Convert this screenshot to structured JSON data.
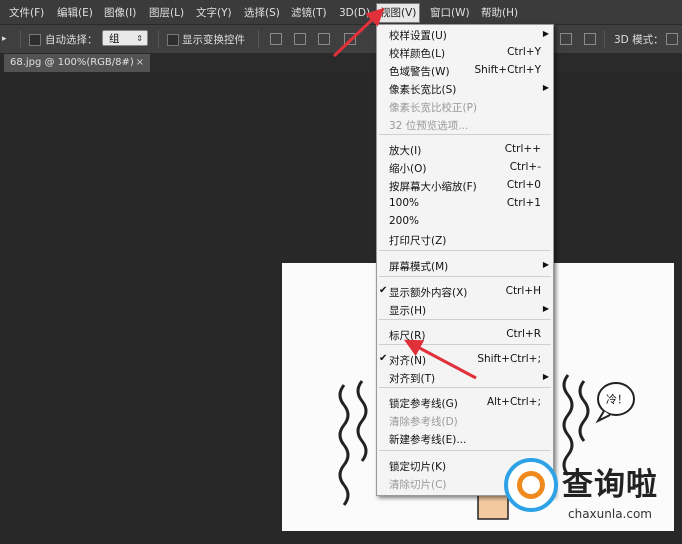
{
  "menubar": {
    "items": [
      "文件(F)",
      "编辑(E)",
      "图像(I)",
      "图层(L)",
      "文字(Y)",
      "选择(S)",
      "滤镜(T)",
      "3D(D)",
      "视图(V)",
      "窗口(W)",
      "帮助(H)"
    ],
    "active_index": 8
  },
  "options_bar": {
    "auto_select_label": "自动选择：",
    "auto_select_value": "组",
    "show_transform_label": "显示变换控件",
    "mode_label": "3D 模式："
  },
  "document_tab": {
    "title": "68.jpg @ 100%(RGB/8#)",
    "close": "×"
  },
  "view_menu": {
    "items": [
      {
        "label": "校样设置(U)",
        "shortcut": "",
        "submenu": true,
        "checked": false,
        "disabled": false
      },
      {
        "label": "校样颜色(L)",
        "shortcut": "Ctrl+Y",
        "submenu": false,
        "checked": false,
        "disabled": false
      },
      {
        "label": "色域警告(W)",
        "shortcut": "Shift+Ctrl+Y",
        "submenu": false,
        "checked": false,
        "disabled": false
      },
      {
        "label": "像素长宽比(S)",
        "shortcut": "",
        "submenu": true,
        "checked": false,
        "disabled": false
      },
      {
        "label": "像素长宽比校正(P)",
        "shortcut": "",
        "submenu": false,
        "checked": false,
        "disabled": true
      },
      {
        "label": "32 位预览选项...",
        "shortcut": "",
        "submenu": false,
        "checked": false,
        "disabled": true
      },
      {
        "label": "放大(I)",
        "shortcut": "Ctrl++",
        "submenu": false,
        "checked": false,
        "disabled": false
      },
      {
        "label": "缩小(O)",
        "shortcut": "Ctrl+-",
        "submenu": false,
        "checked": false,
        "disabled": false
      },
      {
        "label": "按屏幕大小缩放(F)",
        "shortcut": "Ctrl+0",
        "submenu": false,
        "checked": false,
        "disabled": false
      },
      {
        "label": "100%",
        "shortcut": "Ctrl+1",
        "submenu": false,
        "checked": false,
        "disabled": false
      },
      {
        "label": "200%",
        "shortcut": "",
        "submenu": false,
        "checked": false,
        "disabled": false
      },
      {
        "label": "打印尺寸(Z)",
        "shortcut": "",
        "submenu": false,
        "checked": false,
        "disabled": false
      },
      {
        "label": "屏幕模式(M)",
        "shortcut": "",
        "submenu": true,
        "checked": false,
        "disabled": false
      },
      {
        "label": "显示额外内容(X)",
        "shortcut": "Ctrl+H",
        "submenu": false,
        "checked": true,
        "disabled": false
      },
      {
        "label": "显示(H)",
        "shortcut": "",
        "submenu": true,
        "checked": false,
        "disabled": false
      },
      {
        "label": "标尺(R)",
        "shortcut": "Ctrl+R",
        "submenu": false,
        "checked": false,
        "disabled": false
      },
      {
        "label": "对齐(N)",
        "shortcut": "Shift+Ctrl+;",
        "submenu": false,
        "checked": true,
        "disabled": false
      },
      {
        "label": "对齐到(T)",
        "shortcut": "",
        "submenu": true,
        "checked": false,
        "disabled": false
      },
      {
        "label": "锁定参考线(G)",
        "shortcut": "Alt+Ctrl+;",
        "submenu": false,
        "checked": false,
        "disabled": false
      },
      {
        "label": "清除参考线(D)",
        "shortcut": "",
        "submenu": false,
        "checked": false,
        "disabled": true
      },
      {
        "label": "新建参考线(E)...",
        "shortcut": "",
        "submenu": false,
        "checked": false,
        "disabled": false
      },
      {
        "label": "锁定切片(K)",
        "shortcut": "",
        "submenu": false,
        "checked": false,
        "disabled": false
      },
      {
        "label": "清除切片(C)",
        "shortcut": "",
        "submenu": false,
        "checked": false,
        "disabled": true
      }
    ]
  },
  "canvas": {
    "speech_bubble_text": "冷！"
  },
  "watermark": {
    "name": "查询啦",
    "url": "chaxunla.com"
  },
  "icons": {
    "checkmark": "✔",
    "submenu_arrow": "▶",
    "dropdown_arrow": "⇕"
  },
  "colors": {
    "annotation_arrow": "#e0303a",
    "watermark_blue": "#2ea2e6",
    "watermark_orange": "#f08a1f"
  }
}
